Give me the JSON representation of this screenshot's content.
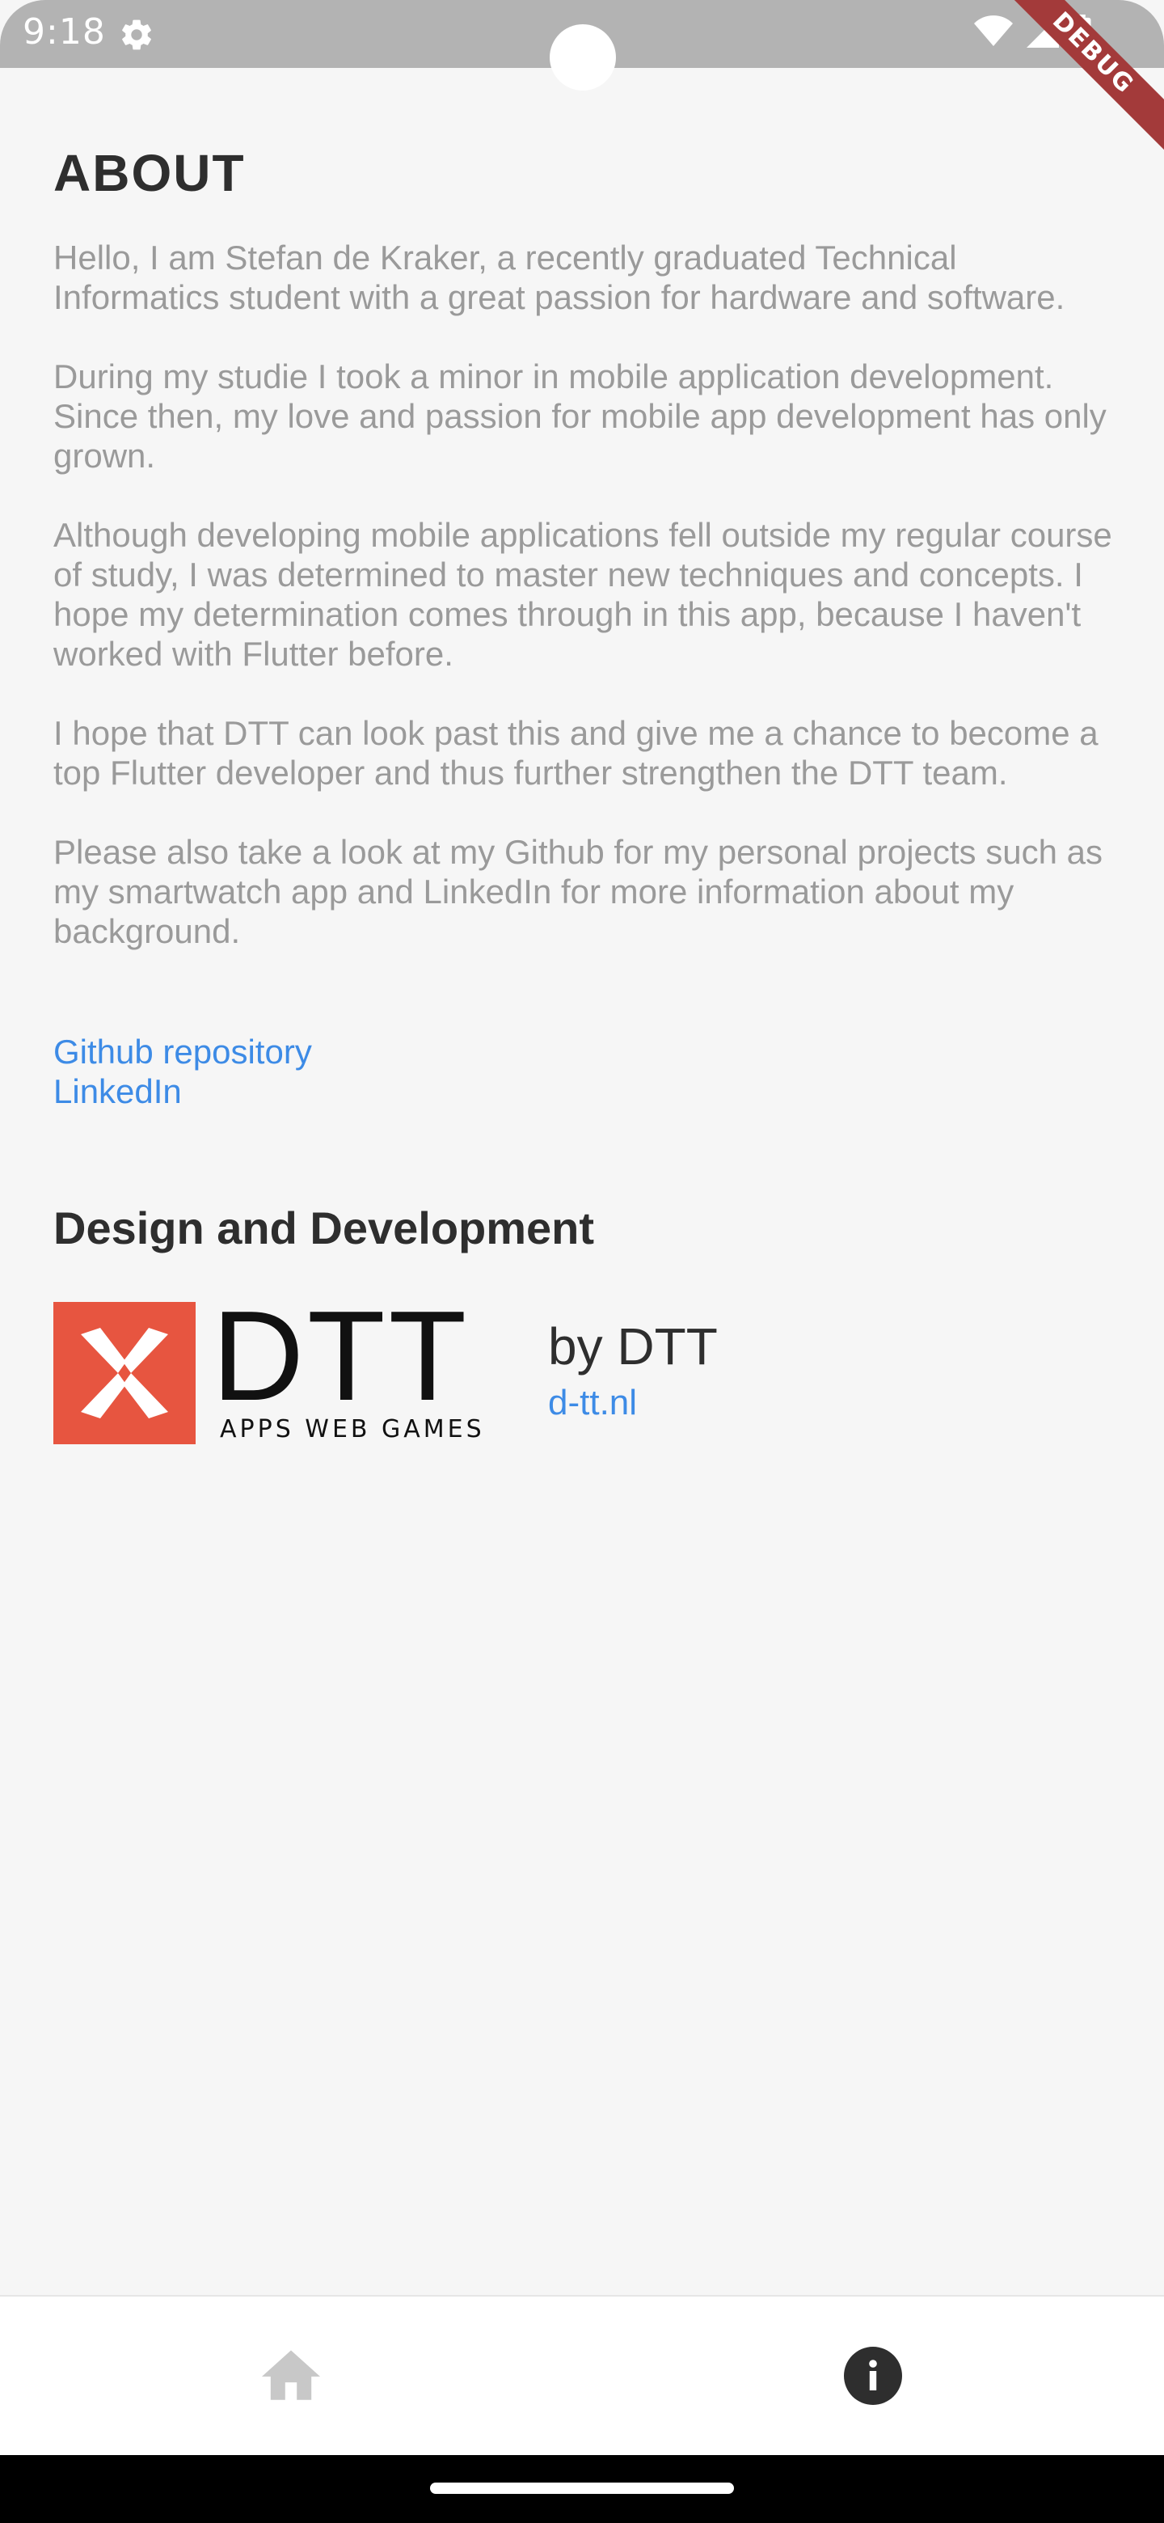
{
  "status_bar": {
    "time": "9:18",
    "icons": [
      "gear-icon",
      "wifi-icon",
      "signal-icon",
      "battery-icon"
    ]
  },
  "debug_banner": "DEBUG",
  "about": {
    "title": "ABOUT",
    "paragraphs": [
      "Hello, I am Stefan de Kraker, a recently graduated Technical Informatics student with a great passion for hardware and software.",
      "During my studie I took a minor in mobile application development. Since then, my love and passion for mobile app development has only grown.",
      "Although developing mobile applications fell outside my regular course of study, I was determined to master new techniques and concepts. I hope my determination comes through in this app, because I haven't worked with Flutter before.",
      "I hope that DTT can look past this and give me a chance to become a top Flutter developer and thus further strengthen the DTT team.",
      "Please also take a look at my Github for my personal projects such as my smartwatch app and LinkedIn for more information about my background."
    ],
    "links": {
      "github": "Github repository",
      "linkedin": "LinkedIn"
    }
  },
  "design": {
    "title": "Design and Development",
    "logo_text": "DTT",
    "logo_subtitle": "APPS WEB GAMES",
    "by_label": "by DTT",
    "website": "d-tt.nl"
  },
  "bottom_nav": {
    "items": [
      {
        "icon": "home-icon",
        "active": false
      },
      {
        "icon": "info-icon",
        "active": true
      }
    ]
  },
  "colors": {
    "background": "#f6f6f6",
    "link": "#3d8be6",
    "logo_red": "#e75540",
    "body_text": "#9a9a9a",
    "heading_text": "#2e2e2e"
  }
}
